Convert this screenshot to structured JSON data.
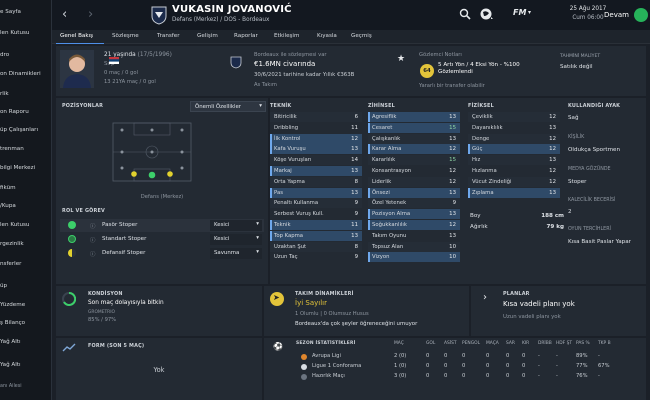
{
  "sidebar": {
    "items": [
      "e Sayfa",
      "len Kutusu",
      "dro",
      "on Dinamikleri",
      "rlik",
      "on Raporu",
      "üp Çalışanları",
      "trenman",
      "bilgi Merkezi",
      "fiküm",
      "/Kupa",
      "len Kutusu",
      "rgezinlik",
      "nsferler",
      "üp",
      "Yüzdeme",
      "ş Bilanço",
      "Yağ Altı",
      "Yağ Altı",
      "anı Ailesi"
    ]
  },
  "topbar": {
    "player_name": "VUKASIN JOVANOVIĆ",
    "player_sub": "Defans (Merkez) / DOS - Bordeaux",
    "date": "25 Ağu 2017",
    "day": "Cum 06:00",
    "continue": "Devam",
    "fm_label": "FM"
  },
  "tabs": [
    "Genel Bakış",
    "Sözleşme",
    "Transfer",
    "Gelişim",
    "Raporlar",
    "Etkileşim",
    "Kıyasla",
    "Geçmiş"
  ],
  "profile": {
    "age": "21 yaşında",
    "dob": "(17/5/1996)",
    "nation": "Sırp",
    "caps": "0 maç / 0 gol",
    "u21": "13 21YA maç / 0 gol",
    "u21_b": "13 21YA maç / 0 gol"
  },
  "contract": {
    "header": "Bordeaux ile sözleşmesi var",
    "value": "€1.6MN civarında",
    "expiry": "30/6/2021 tarihine kadar Yıllık €363B",
    "status": "As Takım"
  },
  "scouting": {
    "header": "Gözlemci Notları",
    "score": "64",
    "text": "5 Artı Yön / 4 Eksi Yön - %100 Gözlemlendi",
    "sub": "Yararlı bir transfer olabilir",
    "price_label": "TAHMİNİ MALİYET",
    "price": "Satılık değil"
  },
  "positions": {
    "header": "POZİSYONLAR",
    "dropdown": "Önemli Özellikler",
    "pitch_label": "Defans (Merkez)"
  },
  "roles": {
    "header": "ROL VE GÖREV",
    "items": [
      {
        "name": "Pasör Stoper",
        "duty": "Kesici"
      },
      {
        "name": "Standart Stoper",
        "duty": "Kesici"
      },
      {
        "name": "Defansif Stoper",
        "duty": "Savunma"
      }
    ]
  },
  "technical": {
    "header": "TEKNİK",
    "items": [
      [
        "Bitiricilik",
        "6"
      ],
      [
        "Dribbling",
        "11"
      ],
      [
        "İlk Kontrol",
        "12"
      ],
      [
        "Kafa Vuruşu",
        "13"
      ],
      [
        "Köşe Vuruşları",
        "14"
      ],
      [
        "Markaj",
        "13"
      ],
      [
        "Orta Yapma",
        "8"
      ],
      [
        "Pas",
        "13"
      ],
      [
        "Penaltı Kullanma",
        "9"
      ],
      [
        "Serbest Vuruş Kull.",
        "9"
      ],
      [
        "Teknik",
        "11"
      ],
      [
        "Top Kapma",
        "13"
      ],
      [
        "Uzaktan Şut",
        "8"
      ],
      [
        "Uzun Taç",
        "9"
      ]
    ]
  },
  "mental": {
    "header": "ZİHİNSEL",
    "items": [
      [
        "Agresiflik",
        "13"
      ],
      [
        "Cesaret",
        "15"
      ],
      [
        "Çalışkanlık",
        "13"
      ],
      [
        "Karar Alma",
        "12"
      ],
      [
        "Kararlılık",
        "15"
      ],
      [
        "Konsantrasyon",
        "12"
      ],
      [
        "Liderlik",
        "12"
      ],
      [
        "Önsezi",
        "13"
      ],
      [
        "Özel Yetenek",
        "9"
      ],
      [
        "Pozisyon Alma",
        "13"
      ],
      [
        "Soğukkanlılık",
        "12"
      ],
      [
        "Takım Oyunu",
        "13"
      ],
      [
        "Topsuz Alan",
        "10"
      ],
      [
        "Vizyon",
        "10"
      ]
    ]
  },
  "physical": {
    "header": "FİZİKSEL",
    "items": [
      [
        "Çeviklik",
        "12"
      ],
      [
        "Dayanıklılık",
        "13"
      ],
      [
        "Denge",
        "12"
      ],
      [
        "Güç",
        "12"
      ],
      [
        "Hız",
        "13"
      ],
      [
        "Hızlanma",
        "12"
      ],
      [
        "Vücut Zindeliği",
        "12"
      ],
      [
        "Zıplama",
        "13"
      ]
    ],
    "height_label": "Boy",
    "height": "188 cm",
    "weight_label": "Ağırlık",
    "weight": "79 kg"
  },
  "info": {
    "foot_label": "KULLANDIĞI AYAK",
    "foot": "Sağ",
    "personality_label": "KİŞİLİK",
    "personality": "Oldukça Sportmen",
    "media_label": "MEDYA GÖZÜNDE",
    "media": "Stoper",
    "ability_label": "KALECİLİK BECERİSİ",
    "ability": "2",
    "pref_label": "OYUN TERCİHLERİ",
    "pref": "Kısa Basit Paslar Yapar"
  },
  "condition": {
    "header": "KONDİSYON",
    "text": "Son maç dolayısıyla bitkin",
    "sub_label": "GROMETRIO",
    "values": "85% / 97%"
  },
  "dynamics": {
    "header": "TAKIM DİNAMİKLERİ",
    "status": "İyi Sayılır",
    "line": "1 Olumlu  |  0 Olumsuz Husus",
    "desc": "Bordeaux'da çok şeyler öğreneceğini umuyor"
  },
  "plans": {
    "header": "PLANLAR",
    "title": "Kısa vadeli planı yok",
    "sub": "Uzun vadeli planı yok"
  },
  "form": {
    "header": "FORM (SON 5 MAÇ)",
    "text": "Yok"
  },
  "season": {
    "header": "SEZON İSTATİSTİKLERİ",
    "columns": [
      "MAÇ",
      "GOL",
      "ASİST",
      "PENGOL",
      "MAÇA",
      "SAR",
      "KIR",
      "DRİBB",
      "HDF ŞT",
      "PAS %",
      "TKP B"
    ],
    "rows": [
      {
        "name": "Avrupa Ligi",
        "cells": [
          "2 (0)",
          "0",
          "0",
          "0",
          "0",
          "0",
          "0",
          "-",
          "-",
          "89%",
          "-"
        ]
      },
      {
        "name": "Ligue 1 Conforama",
        "cells": [
          "1 (0)",
          "0",
          "0",
          "0",
          "0",
          "0",
          "0",
          "-",
          "-",
          "77%",
          "67%"
        ]
      },
      {
        "name": "Hazırlık Maçı",
        "cells": [
          "3 (0)",
          "0",
          "0",
          "0",
          "0",
          "0",
          "0",
          "-",
          "-",
          "76%",
          "-"
        ]
      }
    ]
  },
  "colors": {
    "accent": "#3ccf6a",
    "tabline": "#4e8fe8",
    "panel": "#232a33"
  }
}
